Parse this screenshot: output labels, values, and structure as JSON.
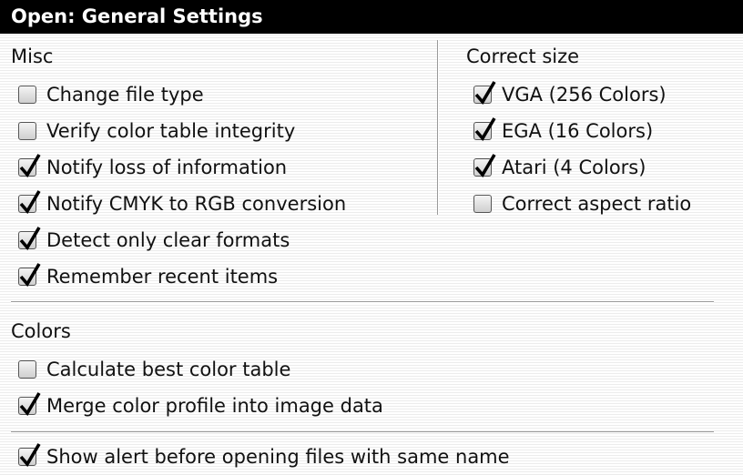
{
  "window": {
    "title": "Open: General Settings"
  },
  "misc": {
    "heading": "Misc",
    "items": [
      {
        "label": "Change file type",
        "checked": false
      },
      {
        "label": "Verify color table integrity",
        "checked": false
      },
      {
        "label": "Notify loss of information",
        "checked": true
      },
      {
        "label": "Notify CMYK to RGB conversion",
        "checked": true
      },
      {
        "label": "Detect only clear formats",
        "checked": true
      },
      {
        "label": "Remember recent items",
        "checked": true
      }
    ]
  },
  "correct_size": {
    "heading": "Correct size",
    "items": [
      {
        "label": "VGA (256 Colors)",
        "checked": true
      },
      {
        "label": "EGA (16 Colors)",
        "checked": true
      },
      {
        "label": "Atari (4 Colors)",
        "checked": true
      },
      {
        "label": "Correct aspect ratio",
        "checked": false
      }
    ]
  },
  "colors": {
    "heading": "Colors",
    "items": [
      {
        "label": "Calculate best color table",
        "checked": false
      },
      {
        "label": "Merge color profile into image data",
        "checked": true
      }
    ]
  },
  "bottom": {
    "items": [
      {
        "label": "Show alert before opening files with same name",
        "checked": true
      }
    ]
  }
}
